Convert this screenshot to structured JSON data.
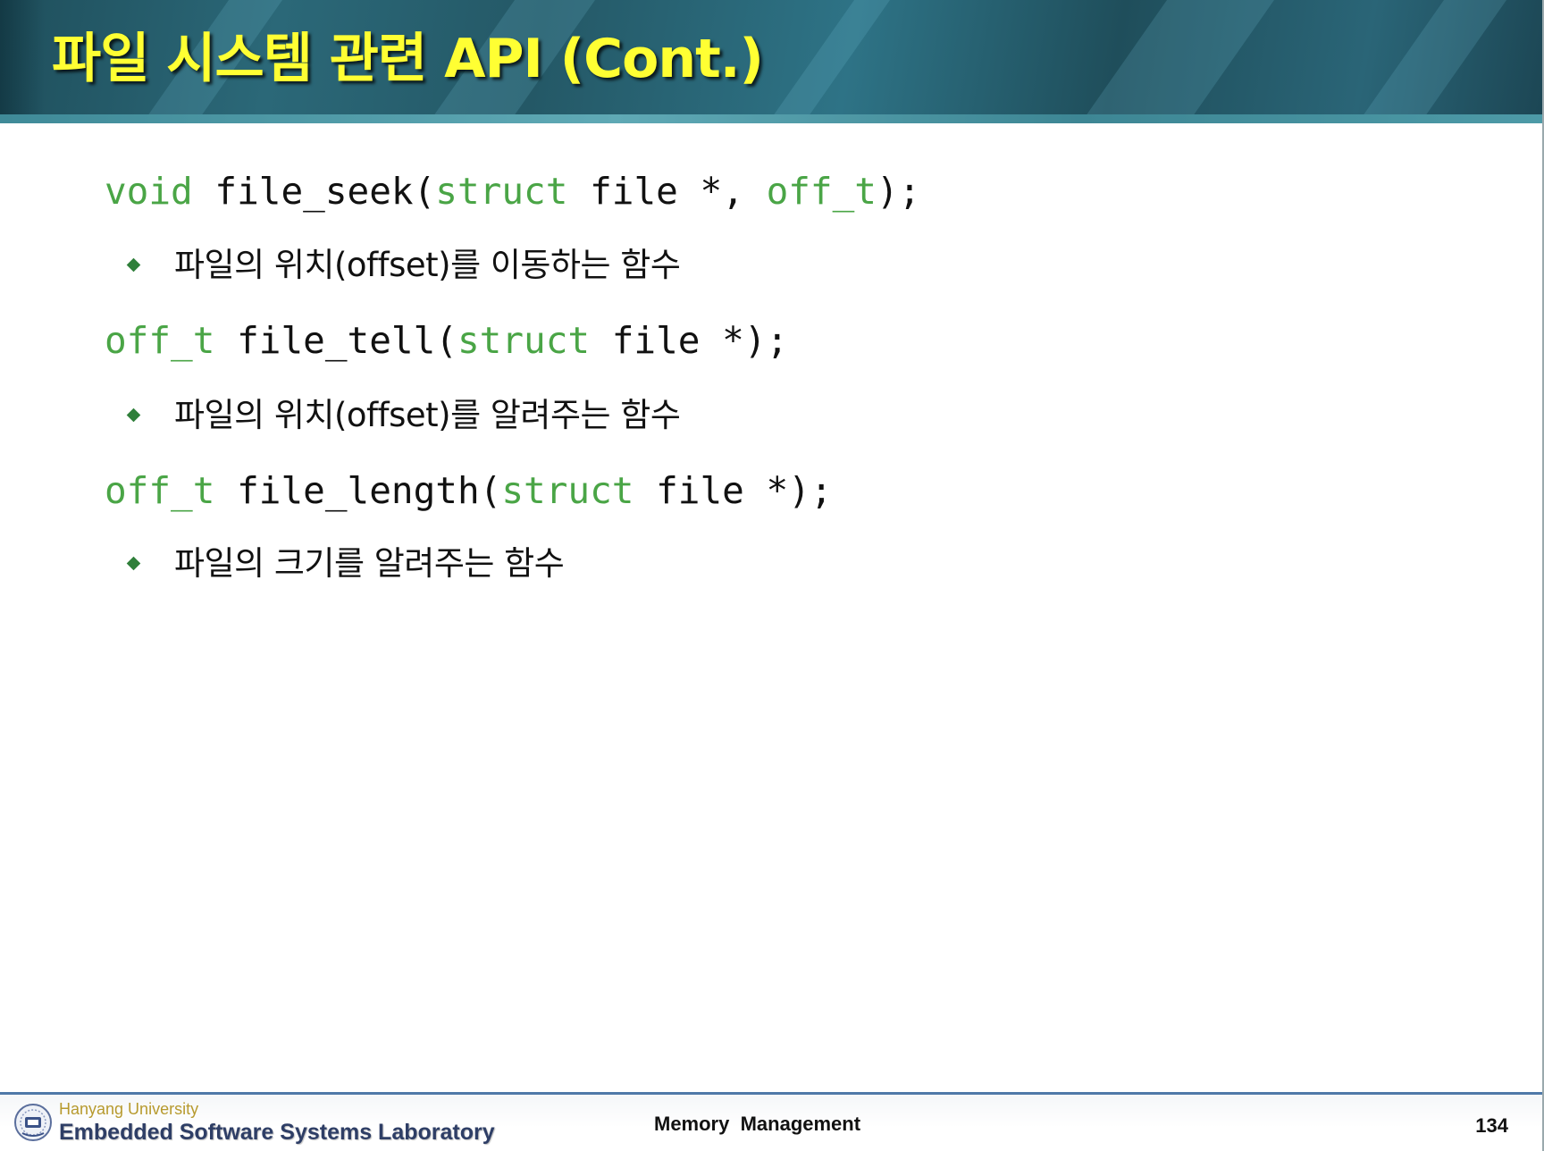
{
  "slide": {
    "title": "파일 시스템 관련 API (Cont.)",
    "accent_color": "#ffff33",
    "keyword_color": "#4aa546",
    "bullet_color": "#2f7f3a"
  },
  "items": [
    {
      "code": {
        "t1": "void",
        "t2": " file_seek(",
        "t3": "struct",
        "t4": " file *, ",
        "t5": "off_t",
        "t6": ");"
      },
      "description": "파일의 위치(offset)를 이동하는 함수"
    },
    {
      "code": {
        "t1": "off_t",
        "t2": " file_tell(",
        "t3": "struct",
        "t4": " file *);"
      },
      "description": "파일의 위치(offset)를 알려주는 함수"
    },
    {
      "code": {
        "t1": "off_t",
        "t2": " file_length(",
        "t3": "struct",
        "t4": " file *);"
      },
      "description": "파일의 크기를 알려주는 함수"
    }
  ],
  "footer": {
    "university": "Hanyang University",
    "lab": "Embedded Software Systems Laboratory",
    "topic": "Memory  Management",
    "page_number": "134",
    "logo_icon": "hanyang-university-emblem-icon"
  }
}
